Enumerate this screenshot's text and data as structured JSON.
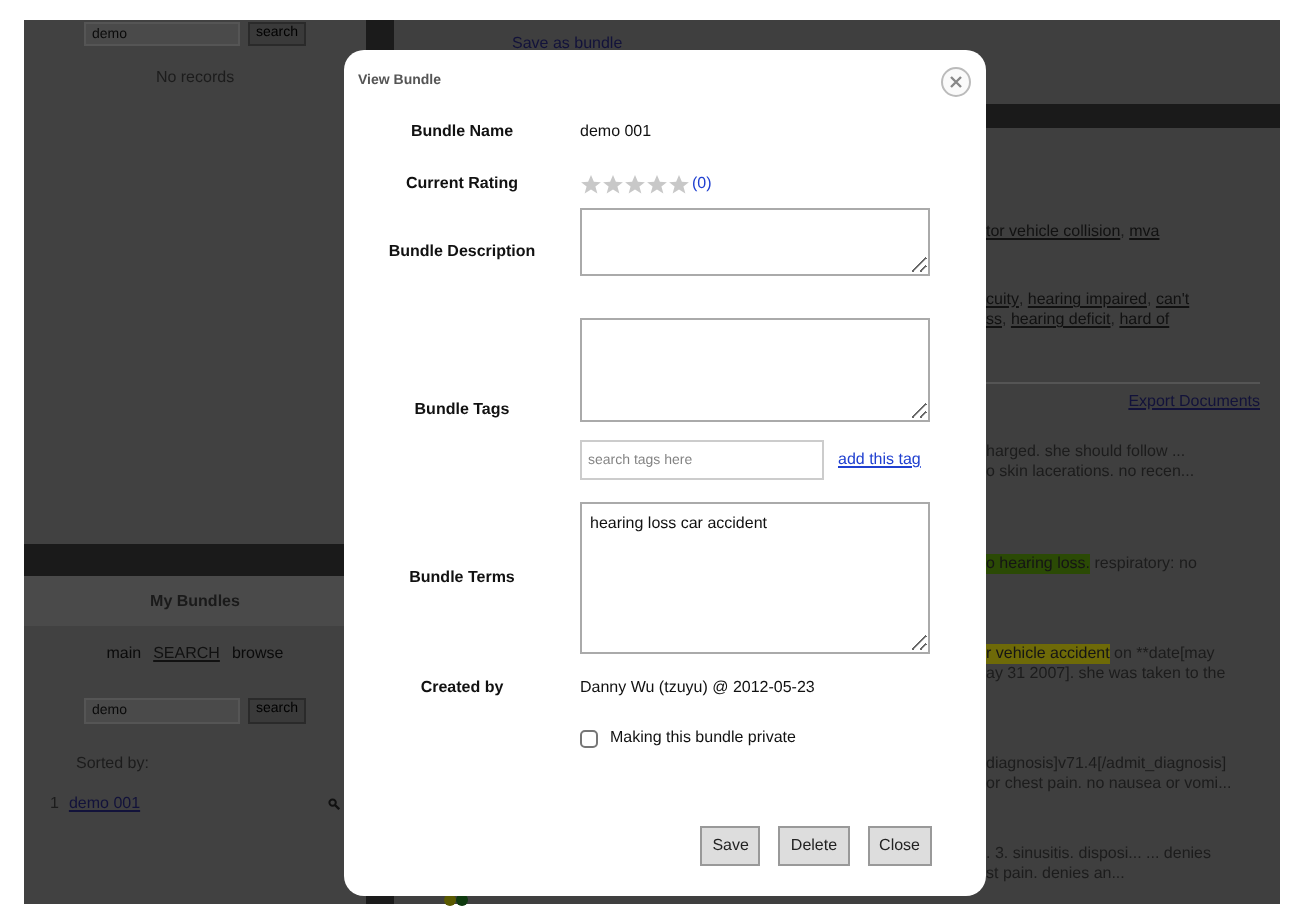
{
  "left_panel": {
    "top_search": {
      "value": "demo",
      "button": "search"
    },
    "no_records": "No records",
    "my_bundles": {
      "heading": "My Bundles",
      "nav": [
        {
          "label": "main",
          "selected": false
        },
        {
          "label": "SEARCH",
          "selected": true
        },
        {
          "label": "browse",
          "selected": false
        }
      ],
      "search": {
        "value": "demo",
        "button": "search"
      },
      "sorted_by": "Sorted by:",
      "results": [
        {
          "index": "1",
          "name": "demo 001"
        }
      ]
    }
  },
  "main_panel": {
    "save_link": "Save as bundle",
    "export_link": "Export Documents",
    "snippets": [
      {
        "lines": [
          [
            {
              "text": "tor vehicle collision",
              "kind": "link"
            },
            {
              "text": ", ",
              "kind": "plain"
            },
            {
              "text": "mva",
              "kind": "link"
            }
          ]
        ]
      },
      {
        "lines": [
          [
            {
              "text": "cuity",
              "kind": "link"
            },
            {
              "text": ", ",
              "kind": "plain"
            },
            {
              "text": "hearing impaired",
              "kind": "link"
            },
            {
              "text": ", ",
              "kind": "plain"
            },
            {
              "text": "can't",
              "kind": "link"
            }
          ],
          [
            {
              "text": "ss",
              "kind": "link"
            },
            {
              "text": ", ",
              "kind": "plain"
            },
            {
              "text": "hearing deficit",
              "kind": "link"
            },
            {
              "text": ", ",
              "kind": "plain"
            },
            {
              "text": "hard of",
              "kind": "link"
            }
          ]
        ]
      },
      {
        "lines": [
          [
            {
              "text": "harged. she should follow ...",
              "kind": "plain"
            }
          ],
          [
            {
              "text": "o skin lacerations. no recen...",
              "kind": "plain"
            }
          ]
        ]
      },
      {
        "lines": [
          [
            {
              "text": "o hearing loss.",
              "kind": "highlight",
              "color": "#2b4a05"
            },
            {
              "text": " respiratory: no",
              "kind": "plain"
            }
          ]
        ]
      },
      {
        "lines": [
          [
            {
              "text": "r vehicle accident",
              "kind": "highlight",
              "color": "#6e6a08"
            },
            {
              "text": " on **date[may",
              "kind": "plain"
            }
          ],
          [
            {
              "text": "ay 31 2007]. she was taken to the",
              "kind": "plain"
            }
          ]
        ]
      },
      {
        "lines": [
          [
            {
              "text": "diagnosis]v71.4[/admit_diagnosis]",
              "kind": "plain"
            }
          ],
          [
            {
              "text": "or chest pain. no nausea or vomi...",
              "kind": "plain"
            }
          ]
        ]
      },
      {
        "lines": [
          [
            {
              "text": ". 3. sinusitis. disposi... ... denies",
              "kind": "plain"
            }
          ],
          [
            {
              "text": "st pain. denies an...",
              "kind": "plain"
            }
          ]
        ]
      }
    ]
  },
  "dialog": {
    "title": "View Bundle",
    "bundle_name": {
      "label": "Bundle Name",
      "value": "demo 001"
    },
    "rating": {
      "label": "Current Rating",
      "stars": 0,
      "count": "(0)"
    },
    "description": {
      "label": "Bundle Description"
    },
    "tags": {
      "label": "Bundle Tags",
      "search_placeholder": "search tags here",
      "add_link": "add this tag"
    },
    "terms": {
      "label": "Bundle Terms",
      "value": "hearing loss car accident"
    },
    "created_by": {
      "label": "Created by",
      "value": "Danny Wu (tzuyu) @ 2012-05-23"
    },
    "private": {
      "label": "Making this bundle private",
      "checked": false
    },
    "buttons": [
      "Save",
      "Delete",
      "Close"
    ]
  }
}
